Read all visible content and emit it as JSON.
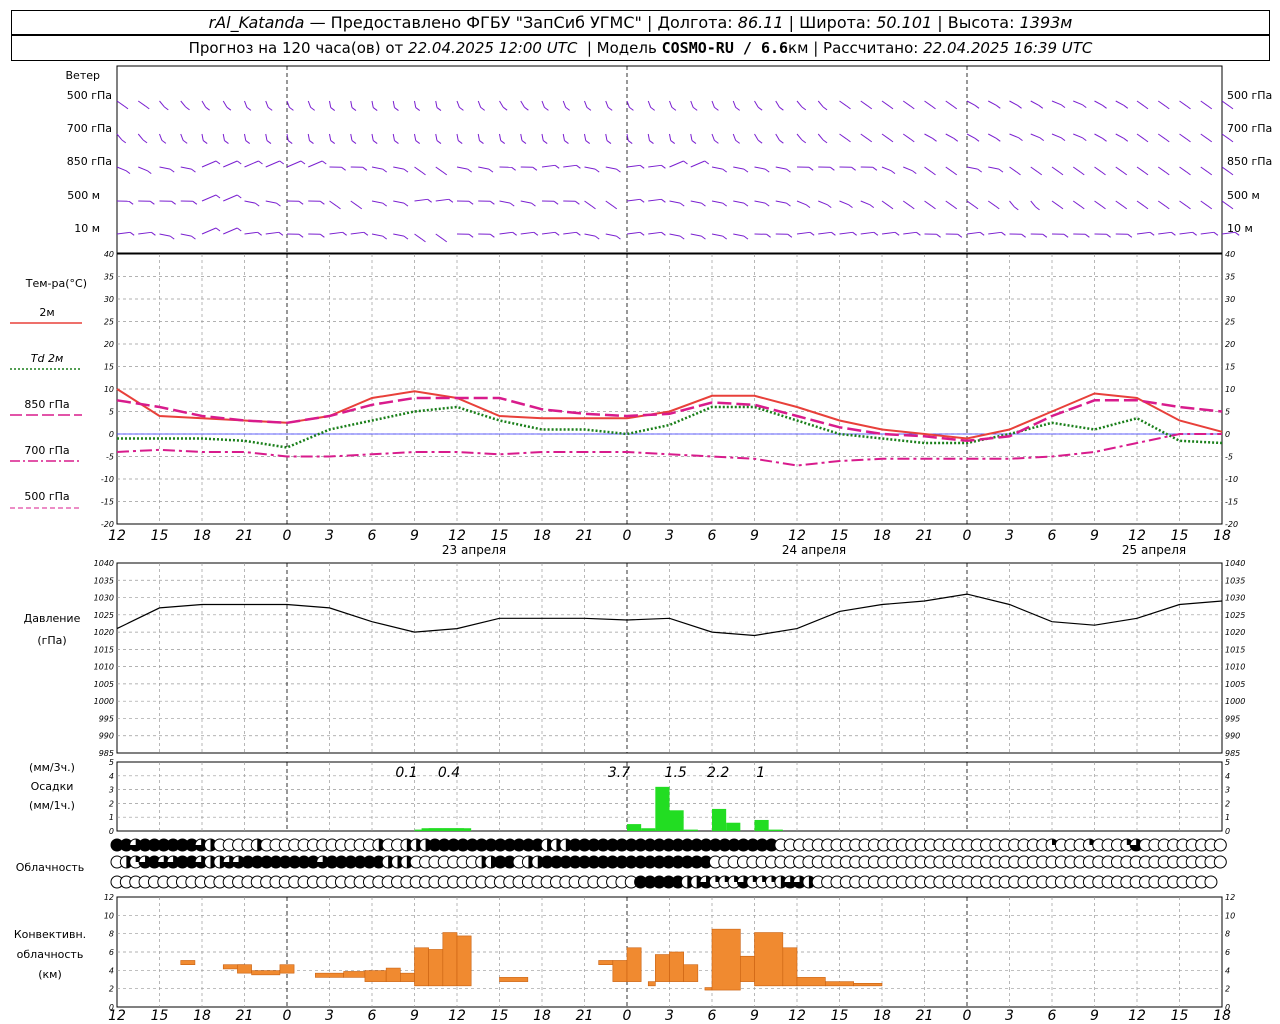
{
  "header": {
    "station": "rAl_Katanda",
    "sep": " — ",
    "provider": "Предоставлено ФГБУ \"ЗапСиб УГМС\"",
    "lon_label": "Долгота:",
    "lon_value": "86.11",
    "lat_label": "Широта:",
    "lat_value": "50.101",
    "alt_label": "Высота:",
    "alt_value": "1393м",
    "forecast_prefix": "Прогноз на 120 часа(ов) от",
    "forecast_time": "22.04.2025 12:00 UTC",
    "model_label": "Модель",
    "model_value": "COSMO-RU / 6.6",
    "model_unit": "км",
    "calc_label": "Рассчитано:",
    "calc_time": "22.04.2025 16:39 UTC"
  },
  "colors": {
    "t2m": "#e8403a",
    "td2m": "#1a7f1a",
    "t850": "#d81b8c",
    "t700": "#d81b8c",
    "t500": "#d81b8c",
    "wind": "#7a1fd0",
    "precip": "#22dd22",
    "conv": "#f08a30",
    "zero_line": "#3030ff"
  },
  "wind_panel": {
    "title": "Ветер",
    "levels": [
      "500 гПа",
      "700 гПа",
      "850 гПа",
      "500 м",
      "10  м"
    ]
  },
  "temp_panel": {
    "title": "Тем-ра(°С)",
    "legend": [
      {
        "label": "2м",
        "style": "solid"
      },
      {
        "label": "Td  2м",
        "style": "dotted"
      },
      {
        "label": "850 гПа",
        "style": "long-dash"
      },
      {
        "label": "700 гПа",
        "style": "dash-dot"
      },
      {
        "label": "500 гПа",
        "style": "dashed"
      }
    ],
    "y_ticks": [
      "40",
      "35",
      "30",
      "25",
      "20",
      "15",
      "10",
      "5",
      "0",
      "-5",
      "-10",
      "-15",
      "-20"
    ]
  },
  "pressure_panel": {
    "title": "Давление",
    "unit": "(гПа)",
    "y_ticks": [
      "1040",
      "1035",
      "1030",
      "1025",
      "1020",
      "1015",
      "1010",
      "1005",
      "1000",
      "995",
      "990",
      "985"
    ]
  },
  "precip_panel": {
    "unit_top": "(мм/3ч.)",
    "title": "Осадки",
    "unit_bottom": "(мм/1ч.)",
    "y_ticks": [
      "5",
      "4",
      "3",
      "2",
      "1",
      "0"
    ],
    "totals": [
      "0.1",
      "0.4",
      "3.7",
      "1.5",
      "2.2",
      "1"
    ]
  },
  "cloud_panel": {
    "title": "Облачность"
  },
  "conv_panel": {
    "title_1": "Конвективн.",
    "title_2": "облачность",
    "unit": "(км)",
    "y_ticks": [
      "12",
      "10",
      "8",
      "6",
      "4",
      "2",
      "0"
    ]
  },
  "x_axis": {
    "hour_ticks": [
      "12",
      "15",
      "18",
      "21",
      "0",
      "3",
      "6",
      "9",
      "12",
      "15",
      "18",
      "21",
      "0",
      "3",
      "6",
      "9",
      "12",
      "15",
      "18",
      "21",
      "0",
      "3",
      "6",
      "9",
      "12",
      "15",
      "18"
    ],
    "days": [
      "23 апреля",
      "24 апреля",
      "25 апреля"
    ]
  },
  "chart_data": {
    "type": "line",
    "x_hours_from_start": [
      0,
      3,
      6,
      9,
      12,
      15,
      18,
      21,
      24,
      27,
      30,
      33,
      36,
      39,
      42,
      45,
      48,
      51,
      54,
      57,
      60,
      63,
      66,
      69,
      72,
      75,
      78
    ],
    "series": [
      {
        "name": "2м",
        "values": [
          10,
          4,
          3.5,
          3,
          2.5,
          4,
          8,
          9.5,
          8,
          4,
          3.5,
          3.5,
          3.5,
          5,
          8.5,
          8.5,
          6,
          3,
          1,
          0,
          -1,
          1,
          5,
          9,
          8,
          3,
          0.5
        ]
      },
      {
        "name": "Td  2м",
        "values": [
          -1,
          -1,
          -1,
          -1.5,
          -3,
          1,
          3,
          5,
          6,
          3,
          1,
          1,
          0,
          2,
          6,
          6,
          3,
          0,
          -1,
          -2,
          -2,
          0,
          2.5,
          1,
          3.5,
          -1.5,
          -2
        ]
      },
      {
        "name": "850 гПа",
        "values": [
          7.5,
          6,
          4,
          3,
          2.5,
          4,
          6.5,
          8,
          8,
          8,
          5.5,
          4.5,
          4,
          4.5,
          7,
          6.5,
          4,
          1.5,
          0,
          -0.5,
          -1.5,
          -0.5,
          4,
          7.5,
          7.5,
          6,
          5
        ]
      },
      {
        "name": "700 гПа",
        "values": [
          -4,
          -3.5,
          -4,
          -4,
          -5,
          -5,
          -4.5,
          -4,
          -4,
          -4.5,
          -4,
          -4,
          -4,
          -4.5,
          -5,
          -5.5,
          -7,
          -6,
          -5.5,
          -5.5,
          -5.5,
          -5.5,
          -5,
          -4,
          -2,
          0,
          0
        ]
      },
      {
        "name": "Давление (гПа)",
        "values": [
          1021,
          1027,
          1028,
          1028,
          1028,
          1027,
          1023,
          1020,
          1021,
          1024,
          1024,
          1024,
          1023.5,
          1024,
          1020,
          1019,
          1021,
          1026,
          1028,
          1029,
          1031,
          1028,
          1023,
          1022,
          1024,
          1028,
          1029
        ]
      }
    ],
    "precip_mm": {
      "hours": [
        21,
        21.5,
        22,
        22.5,
        23,
        23.5,
        24,
        36,
        37,
        38,
        39,
        40,
        42,
        43,
        45,
        46
      ],
      "values": [
        0.1,
        0.2,
        0.2,
        0.2,
        0.2,
        0.2,
        0.2,
        0.5,
        0.2,
        3.2,
        1.5,
        0.1,
        1.6,
        0.6,
        0.8,
        0.1
      ]
    },
    "convective_cloud_km": {
      "segments": [
        {
          "from": 4.5,
          "to": 5.5,
          "base": 5.0,
          "top": 5.5
        },
        {
          "from": 7.5,
          "to": 9.0,
          "base": 4.5,
          "top": 5.0
        },
        {
          "from": 8.5,
          "to": 9.5,
          "base": 4.0,
          "top": 5.0
        },
        {
          "from": 9.5,
          "to": 11.5,
          "base": 3.8,
          "top": 4.3
        },
        {
          "from": 11.5,
          "to": 12.5,
          "base": 4.0,
          "top": 5.0
        },
        {
          "from": 14.0,
          "to": 16.0,
          "base": 3.5,
          "top": 4.0
        },
        {
          "from": 16.0,
          "to": 17.5,
          "base": 3.5,
          "top": 4.2
        },
        {
          "from": 17.5,
          "to": 19.0,
          "base": 3.0,
          "top": 4.3
        },
        {
          "from": 19.0,
          "to": 20.0,
          "base": 3.0,
          "top": 4.6
        },
        {
          "from": 20.0,
          "to": 21.0,
          "base": 3.0,
          "top": 4.0
        },
        {
          "from": 21.0,
          "to": 22.0,
          "base": 2.5,
          "top": 7.0
        },
        {
          "from": 22.0,
          "to": 23.0,
          "base": 2.5,
          "top": 6.8
        },
        {
          "from": 23.0,
          "to": 24.0,
          "base": 2.5,
          "top": 8.8
        },
        {
          "from": 24.0,
          "to": 25.0,
          "base": 2.5,
          "top": 8.4
        },
        {
          "from": 27.0,
          "to": 29.0,
          "base": 3.0,
          "top": 3.5
        },
        {
          "from": 34.0,
          "to": 35.0,
          "base": 5.0,
          "top": 5.5
        },
        {
          "from": 35.0,
          "to": 36.0,
          "base": 3.0,
          "top": 5.5
        },
        {
          "from": 36.0,
          "to": 37.0,
          "base": 3.0,
          "top": 7.0
        },
        {
          "from": 37.5,
          "to": 38.0,
          "base": 2.5,
          "top": 3.0
        },
        {
          "from": 38.0,
          "to": 39.0,
          "base": 3.0,
          "top": 6.2
        },
        {
          "from": 39.0,
          "to": 40.0,
          "base": 3.0,
          "top": 6.5
        },
        {
          "from": 40.0,
          "to": 41.0,
          "base": 3.0,
          "top": 5.0
        },
        {
          "from": 41.5,
          "to": 42.0,
          "base": 2.0,
          "top": 2.3
        },
        {
          "from": 42.0,
          "to": 44.0,
          "base": 2.0,
          "top": 9.2
        },
        {
          "from": 44.0,
          "to": 45.0,
          "base": 3.0,
          "top": 6.0
        },
        {
          "from": 45.0,
          "to": 47.0,
          "base": 2.5,
          "top": 8.8
        },
        {
          "from": 47.0,
          "to": 48.0,
          "base": 2.5,
          "top": 7.0
        },
        {
          "from": 48.0,
          "to": 50.0,
          "base": 2.5,
          "top": 3.5
        },
        {
          "from": 50.0,
          "to": 52.0,
          "base": 2.5,
          "top": 3.0
        },
        {
          "from": 52.0,
          "to": 54.0,
          "base": 2.5,
          "top": 2.8
        }
      ]
    },
    "cloud_cover_octas_rows": {
      "rows": [
        [
          8,
          8,
          6,
          8,
          8,
          8,
          8,
          8,
          8,
          6,
          4,
          0,
          0,
          0,
          0,
          4,
          0,
          0,
          0,
          0,
          0,
          0,
          0,
          0,
          0,
          0,
          0,
          0,
          4,
          0,
          0,
          4,
          4,
          4,
          8,
          8,
          8,
          8,
          8,
          8,
          8,
          8,
          8,
          8,
          8,
          8,
          4,
          4,
          4,
          8,
          8,
          8,
          8,
          8,
          8,
          8,
          8,
          8,
          8,
          8,
          8,
          8,
          8,
          8,
          8,
          8,
          8,
          8,
          8,
          8,
          8,
          0,
          0,
          0,
          0,
          0,
          0,
          0,
          0,
          0,
          0,
          0,
          0,
          0,
          0,
          0,
          0,
          0,
          0,
          0,
          0,
          0,
          0,
          0,
          0,
          0,
          0,
          0,
          0,
          0,
          2,
          0,
          0,
          0,
          2,
          0,
          0,
          0,
          2,
          6,
          0,
          0,
          0,
          0,
          0,
          0,
          0,
          0,
          0,
          0
        ],
        [
          0,
          4,
          2,
          6,
          8,
          6,
          6,
          8,
          8,
          6,
          4,
          4,
          6,
          6,
          8,
          8,
          8,
          8,
          8,
          8,
          8,
          8,
          6,
          8,
          8,
          8,
          8,
          8,
          8,
          4,
          4,
          4,
          0,
          0,
          0,
          0,
          0,
          0,
          0,
          4,
          4,
          8,
          8,
          0,
          4,
          4,
          8,
          8,
          8,
          8,
          8,
          8,
          8,
          8,
          8,
          8,
          8,
          8,
          8,
          8,
          8,
          8,
          8,
          8,
          0,
          0,
          0,
          0,
          0,
          0,
          0,
          0,
          0,
          0,
          0,
          0,
          0,
          0,
          0,
          0,
          0,
          0,
          0,
          0,
          0,
          0,
          0,
          0,
          0,
          0,
          0,
          0,
          0,
          0,
          0,
          0,
          0,
          0,
          0,
          0,
          0,
          0,
          0,
          0,
          0,
          0,
          0,
          0,
          0,
          0,
          0,
          0,
          0,
          0,
          0,
          0,
          0,
          0,
          0
        ],
        [
          0,
          0,
          0,
          0,
          0,
          0,
          0,
          0,
          0,
          0,
          0,
          0,
          0,
          0,
          0,
          0,
          0,
          0,
          0,
          0,
          0,
          0,
          0,
          0,
          0,
          0,
          0,
          0,
          0,
          0,
          0,
          0,
          0,
          0,
          0,
          0,
          0,
          0,
          0,
          0,
          0,
          0,
          0,
          0,
          0,
          0,
          0,
          0,
          0,
          0,
          0,
          0,
          0,
          0,
          0,
          0,
          8,
          8,
          8,
          8,
          8,
          4,
          4,
          6,
          2,
          2,
          2,
          6,
          2,
          2,
          2,
          4,
          6,
          6,
          4,
          0,
          0,
          0,
          0,
          0,
          0,
          0,
          0,
          0,
          0,
          0,
          0,
          0,
          0,
          0,
          0,
          0,
          0,
          0,
          0,
          0,
          0,
          0,
          0,
          0,
          0,
          0,
          0,
          0,
          0,
          0,
          0,
          0,
          0,
          0,
          0,
          0,
          0,
          0,
          0,
          0,
          0,
          0
        ]
      ]
    },
    "xlabel": "",
    "ylabel": "Тем-ра(°С)",
    "ylim": [
      -20,
      40
    ]
  }
}
